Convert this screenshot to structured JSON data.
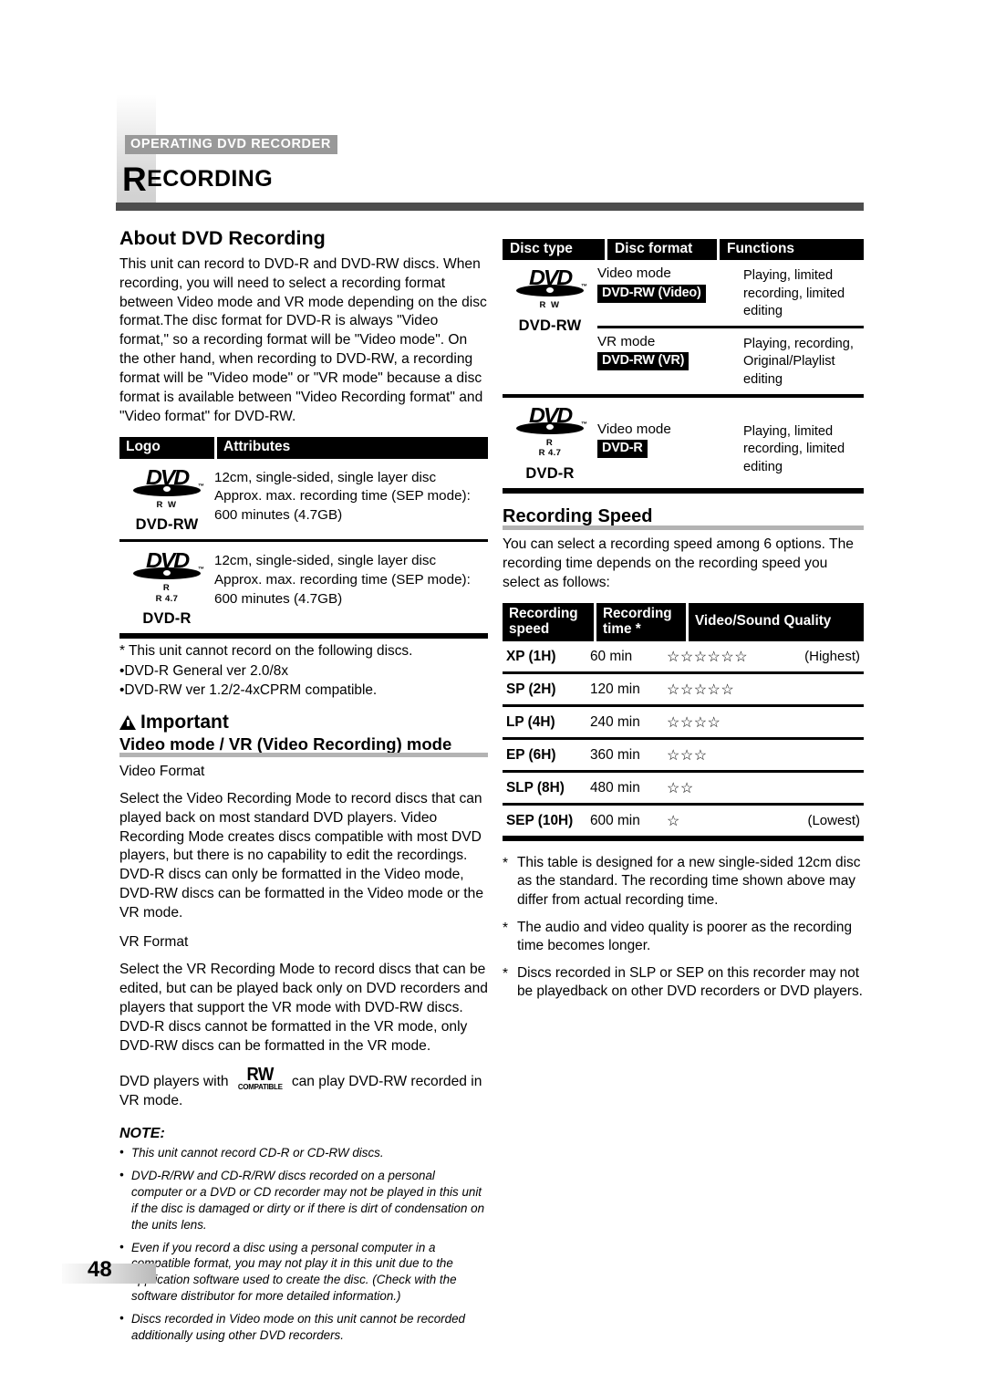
{
  "header": {
    "kicker": "OPERATING DVD RECORDER",
    "chapter_initial": "R",
    "chapter_rest": "ECORDING"
  },
  "left": {
    "about": {
      "heading": "About DVD Recording",
      "paragraph": "This unit can record to DVD-R and DVD-RW discs. When recording, you will need to select a recording format between Video mode and VR mode depending on the disc format.The disc format for DVD-R is always \"Video format,\" so a recording format will be \"Video mode\". On the other hand, when recording to DVD-RW, a recording format will be \"Video mode\" or \"VR mode\" because a disc format is available between \"Video Recording format\" and \"Video format\" for DVD-RW."
    },
    "logo_table": {
      "col_logo": "Logo",
      "col_attributes": "Attributes",
      "rows": [
        {
          "logo_word": "DVD",
          "logo_sub": "R W",
          "logo_sub2": "",
          "logo_name": "DVD-RW",
          "attr_lines": [
            "12cm, single-sided, single layer disc",
            "Approx. max. recording time (SEP mode):",
            "600 minutes (4.7GB)"
          ]
        },
        {
          "logo_word": "DVD",
          "logo_sub": "R",
          "logo_sub2": "R 4.7",
          "logo_name": "DVD-R",
          "attr_lines": [
            "12cm, single-sided, single layer disc",
            "Approx. max. recording time (SEP mode):",
            "600 minutes (4.7GB)"
          ]
        }
      ]
    },
    "cannot_record": [
      "* This unit cannot record on the following discs.",
      "•DVD-R General ver 2.0/8x",
      "•DVD-RW ver 1.2/2-4xCPRM compatible."
    ],
    "important_label": "Important",
    "mode_heading": "Video mode / VR (Video Recording) mode",
    "video_format_label": "Video Format",
    "video_format_text": "Select the Video Recording Mode to record discs that can played back on most standard DVD players. Video Recording Mode creates discs compatible with most DVD players, but there is no capability to edit the recordings. DVD-R discs can only be formatted in the Video mode, DVD-RW discs can be formatted in the Video mode or the VR mode.",
    "vr_format_label": "VR Format",
    "vr_format_text": "Select the VR Recording Mode to record discs that can be edited, but can be played back only on DVD recorders and players that support the VR mode with DVD-RW discs. DVD-R discs cannot be formatted in the VR mode, only DVD-RW discs can be formatted in the VR mode.",
    "rw_sentence_before": "DVD players with",
    "rw_badge_top": "RW",
    "rw_badge_bottom": "COMPATIBLE",
    "rw_sentence_after": "can play DVD-RW recorded in VR mode.",
    "note_title": "NOTE:",
    "notes": [
      "This unit cannot record CD-R or CD-RW discs.",
      "DVD-R/RW and CD-R/RW discs recorded on a personal computer or a DVD or CD recorder may not be played in this unit if the disc is damaged or dirty or if there is dirt of condensation on the units lens.",
      "Even if you record a disc using a personal computer in a compatible format, you may not play it in this unit due to the application software used to create the disc. (Check with the software distributor for more detailed information.)",
      "Discs recorded in Video mode on this unit cannot be recorded additionally using other DVD recorders."
    ]
  },
  "right": {
    "disc_table": {
      "col_disc_type": "Disc type",
      "col_disc_format": "Disc format",
      "col_functions": "Functions",
      "groups": [
        {
          "logo_word": "DVD",
          "logo_sub": "R W",
          "logo_sub2": "",
          "logo_name": "DVD-RW",
          "rows": [
            {
              "mode_label": "Video mode",
              "tag": "DVD-RW (Video)",
              "functions": "Playing, limited recording, limited editing"
            },
            {
              "mode_label": "VR mode",
              "tag": "DVD-RW (VR)",
              "functions": "Playing, recording, Original/Playlist editing"
            }
          ]
        },
        {
          "logo_word": "DVD",
          "logo_sub": "R",
          "logo_sub2": "R 4.7",
          "logo_name": "DVD-R",
          "rows": [
            {
              "mode_label": "Video mode",
              "tag": "DVD-R",
              "functions": "Playing, limited recording, limited editing"
            }
          ]
        }
      ]
    },
    "speed": {
      "heading": "Recording Speed",
      "intro": "You can select a recording speed among 6 options. The recording time depends on the recording speed you select as follows:",
      "col_speed": "Recording speed",
      "col_time": "Recording time *",
      "col_quality": "Video/Sound Quality",
      "rows": [
        {
          "speed": "XP (1H)",
          "time": "60 min",
          "stars": "☆☆☆☆☆☆",
          "star_count": 6,
          "note": "(Highest)"
        },
        {
          "speed": "SP (2H)",
          "time": "120 min",
          "stars": "☆☆☆☆☆",
          "star_count": 5,
          "note": ""
        },
        {
          "speed": "LP (4H)",
          "time": "240 min",
          "stars": "☆☆☆☆",
          "star_count": 4,
          "note": ""
        },
        {
          "speed": "EP (6H)",
          "time": "360 min",
          "stars": "☆☆☆",
          "star_count": 3,
          "note": ""
        },
        {
          "speed": "SLP (8H)",
          "time": "480 min",
          "stars": "☆☆",
          "star_count": 2,
          "note": ""
        },
        {
          "speed": "SEP (10H)",
          "time": "600 min",
          "stars": "☆",
          "star_count": 1,
          "note": "(Lowest)"
        }
      ]
    },
    "footnotes": [
      "This table is designed for a new single-sided 12cm disc as the standard. The recording time shown above may differ from actual recording time.",
      "The audio and video quality is poorer as the recording time becomes longer.",
      "Discs recorded in SLP or SEP on this recorder may not be playedback on other DVD recorders or DVD players."
    ]
  },
  "footer": {
    "page_number": "48"
  }
}
